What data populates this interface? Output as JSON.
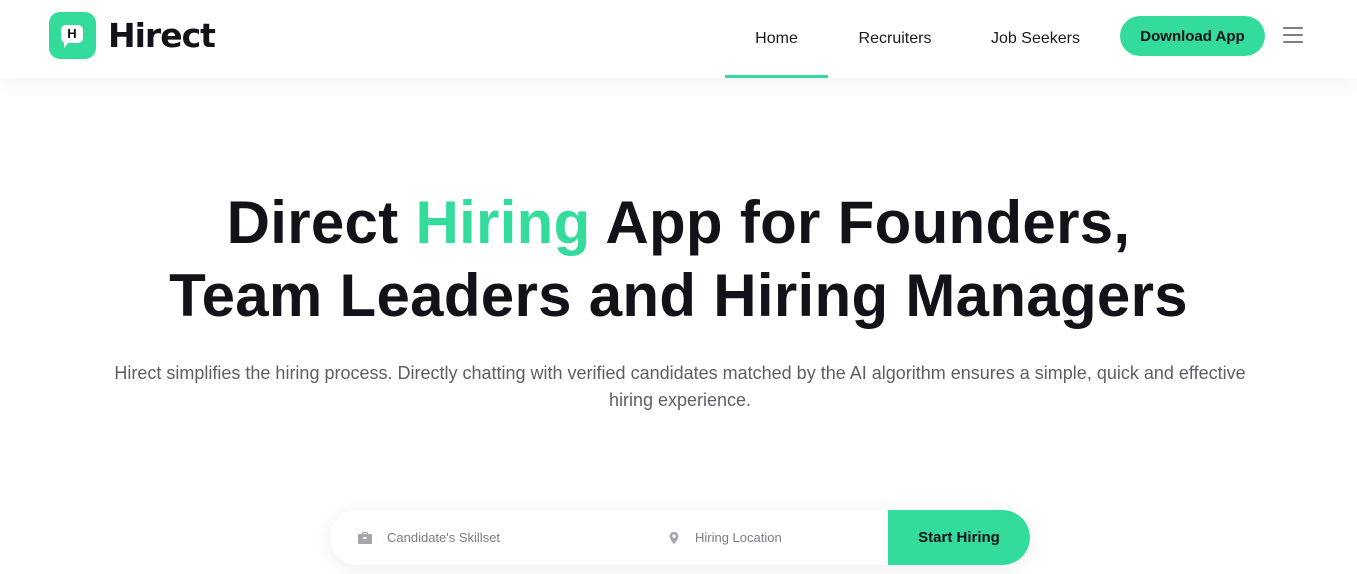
{
  "brand": {
    "name": "Hirect",
    "mark_letter": "H",
    "accent_color": "#33dc9b"
  },
  "nav": {
    "items": [
      {
        "label": "Home",
        "active": true
      },
      {
        "label": "Recruiters",
        "active": false
      },
      {
        "label": "Job Seekers",
        "active": false
      }
    ],
    "download_label": "Download App",
    "menu_icon": "hamburger-menu-icon"
  },
  "hero": {
    "title_part1": "Direct ",
    "title_accent": "Hiring",
    "title_part2": " App for Founders,",
    "title_line2": "Team Leaders and Hiring Managers",
    "subtitle": "Hirect simplifies the hiring process. Directly chatting with verified candidates matched by the AI algorithm ensures a simple, quick and effective hiring experience."
  },
  "search": {
    "skill_placeholder": "Candidate's Skillset",
    "skill_icon": "briefcase-icon",
    "location_placeholder": "Hiring Location",
    "location_icon": "location-pin-icon",
    "submit_label": "Start Hiring"
  }
}
